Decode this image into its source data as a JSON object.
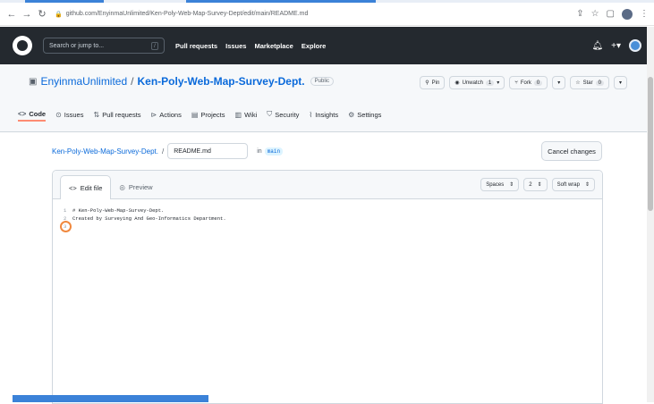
{
  "browser": {
    "url": "github.com/EnyinmaUnlimited/Ken-Poly-Web-Map-Survey-Dept/edit/main/README.md"
  },
  "header": {
    "search_placeholder": "Search or jump to...",
    "search_key": "/",
    "nav": [
      "Pull requests",
      "Issues",
      "Marketplace",
      "Explore"
    ]
  },
  "repo": {
    "owner": "EnyinmaUnlimited",
    "separator": "/",
    "name": "Ken-Poly-Web-Map-Survey-Dept.",
    "visibility": "Public",
    "actions": {
      "pin": "Pin",
      "unwatch": "Unwatch",
      "unwatch_count": "1",
      "fork": "Fork",
      "fork_count": "0",
      "star": "Star",
      "star_count": "0"
    }
  },
  "tabs": [
    {
      "label": "Code",
      "icon": "code-icon"
    },
    {
      "label": "Issues",
      "icon": "issue-icon"
    },
    {
      "label": "Pull requests",
      "icon": "pull-request-icon"
    },
    {
      "label": "Actions",
      "icon": "play-icon"
    },
    {
      "label": "Projects",
      "icon": "table-icon"
    },
    {
      "label": "Wiki",
      "icon": "book-icon"
    },
    {
      "label": "Security",
      "icon": "shield-icon"
    },
    {
      "label": "Insights",
      "icon": "graph-icon"
    },
    {
      "label": "Settings",
      "icon": "gear-icon"
    }
  ],
  "editor": {
    "repo_link": "Ken-Poly-Web-Map-Survey-Dept.",
    "path_sep": "/",
    "filename": "README.md",
    "in_label": "in",
    "branch": "main",
    "cancel": "Cancel changes",
    "tab_edit": "Edit file",
    "tab_preview": "Preview",
    "indent_mode": "Spaces",
    "indent_size": "2",
    "wrap_mode": "Soft wrap",
    "lines": [
      {
        "n": "1",
        "text": "# Ken-Poly-Web-Map-Survey-Dept."
      },
      {
        "n": "2",
        "text": "Created by Surveying And Geo-Informatics Department."
      },
      {
        "n": "3",
        "text": ""
      }
    ]
  },
  "colors": {
    "header_bg": "#24292f",
    "link": "#0969da",
    "active_tab_underline": "#fd8c73",
    "highlight_circle": "#f0883e"
  }
}
